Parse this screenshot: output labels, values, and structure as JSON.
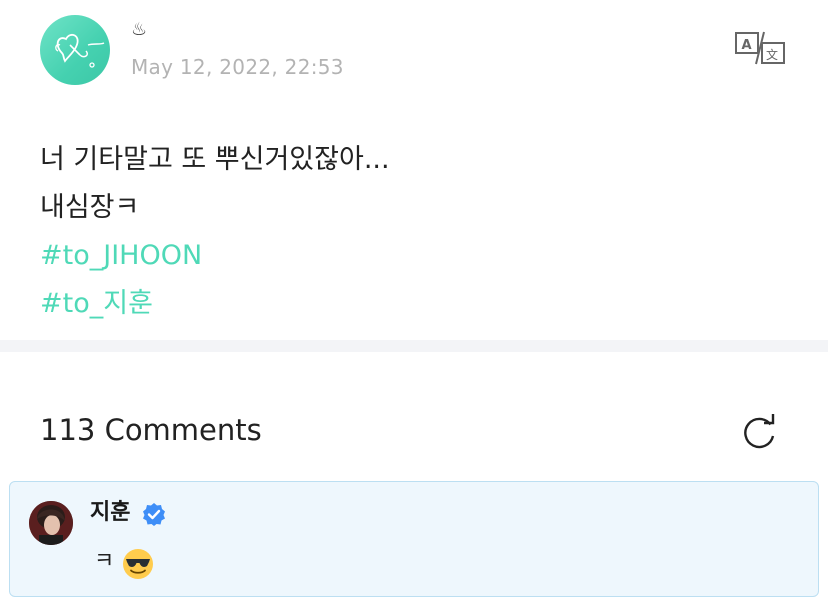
{
  "post": {
    "username": "♨",
    "timestamp": "May 12, 2022, 22:53",
    "lines": [
      "너 기타말고 또 뿌신거있잖아...",
      "내심장ㅋ"
    ],
    "hashtags": [
      "#to_JIHOON",
      "#to_지훈"
    ]
  },
  "icons": {
    "avatar": "heart-doodle-avatar",
    "translate": "translate-icon",
    "refresh": "refresh-icon",
    "verified": "verified-badge-icon",
    "emoji": "sunglasses-emoji"
  },
  "comments": {
    "count_label": "113 Comments",
    "items": [
      {
        "author": "지훈",
        "verified": true,
        "text": "ㅋ",
        "emoji": "sunglasses-emoji"
      }
    ]
  },
  "colors": {
    "hashtag": "#4fd9b7",
    "timestamp": "#b3b3b3",
    "comment_bg": "#eef7fd",
    "comment_border": "#bcdff2",
    "verified": "#3e8ef7"
  }
}
